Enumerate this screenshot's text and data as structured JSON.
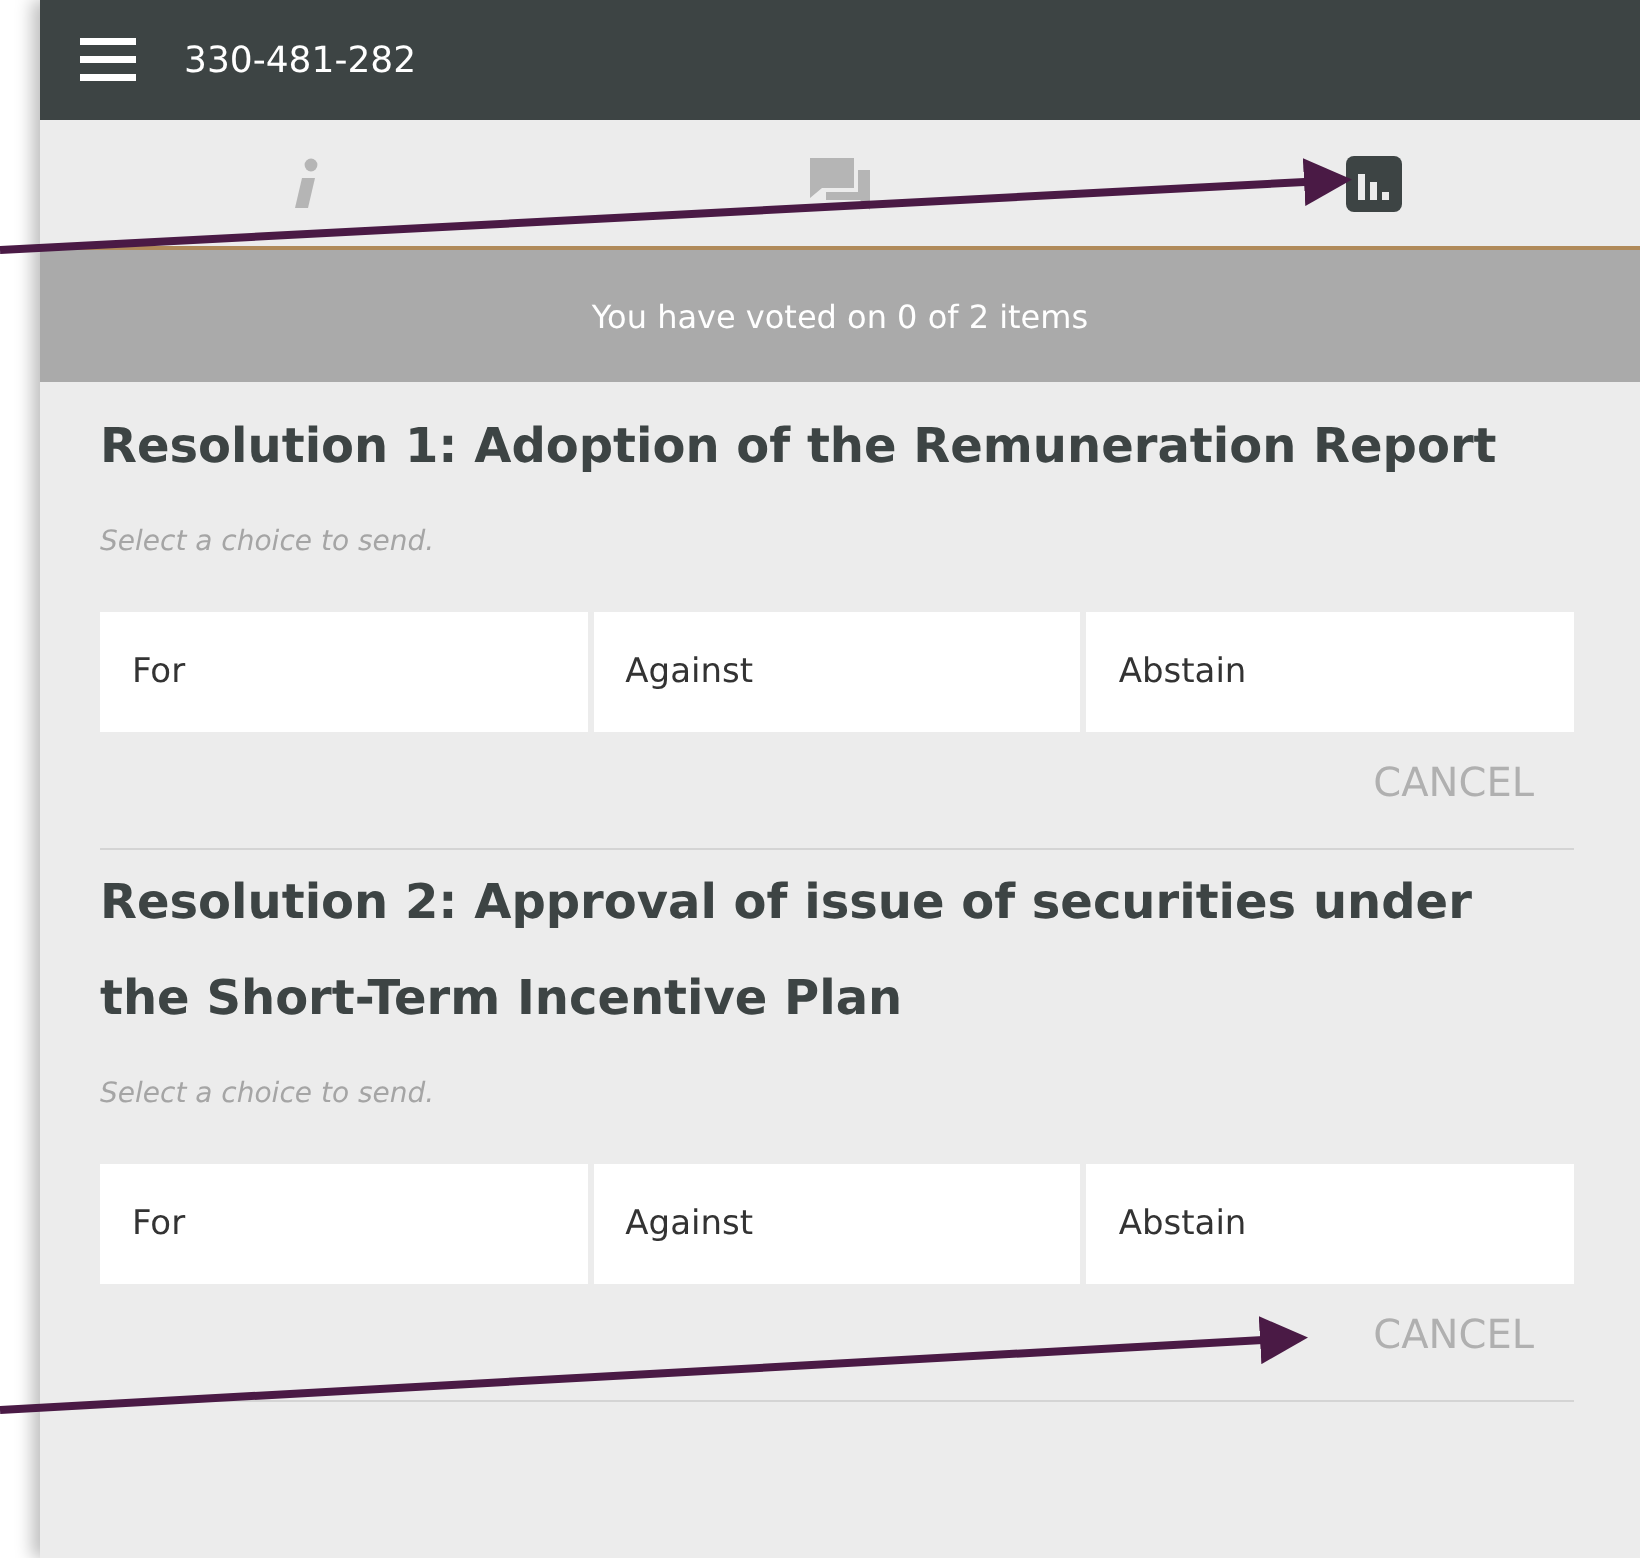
{
  "header": {
    "title": "330-481-282"
  },
  "tabs": [
    {
      "kind": "info",
      "selected": false
    },
    {
      "kind": "chat",
      "selected": false
    },
    {
      "kind": "chart",
      "selected": true
    }
  ],
  "status": "You have voted on 0 of 2 items",
  "resolutions": [
    {
      "title": "Resolution 1: Adoption of the Remuneration Report",
      "hint": "Select a choice to send.",
      "choices": [
        {
          "label": "For",
          "selected": false
        },
        {
          "label": "Against",
          "selected": false
        },
        {
          "label": "Abstain",
          "selected": false
        }
      ],
      "cancel": "CANCEL"
    },
    {
      "title": "Resolution 2: Approval of issue of securities under the Short-Term Incentive Plan",
      "hint": "Select a choice to send.",
      "choices": [
        {
          "label": "For",
          "selected": false
        },
        {
          "label": "Against",
          "selected": false
        },
        {
          "label": "Abstain",
          "selected": false
        }
      ],
      "cancel": "CANCEL"
    }
  ]
}
